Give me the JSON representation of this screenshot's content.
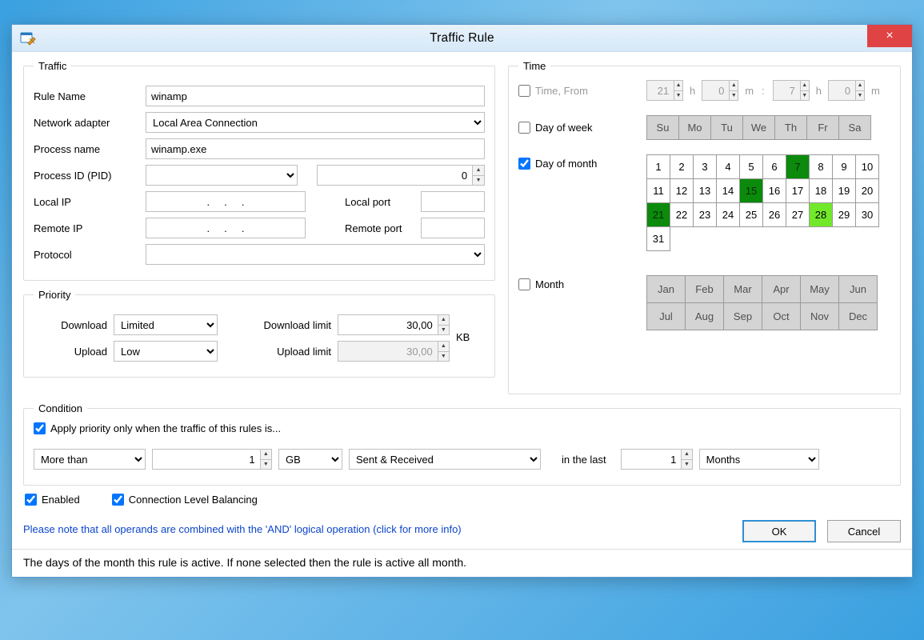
{
  "window": {
    "title": "Traffic Rule",
    "close_label": "×"
  },
  "traffic": {
    "legend": "Traffic",
    "rule_name_label": "Rule Name",
    "rule_name": "winamp",
    "network_adapter_label": "Network adapter",
    "network_adapter": "Local Area Connection",
    "process_name_label": "Process name",
    "process_name": "winamp.exe",
    "pid_label": "Process ID (PID)",
    "pid_select": "",
    "pid_value": "0",
    "local_ip_label": "Local IP",
    "local_ip": ".     .     .",
    "local_port_label": "Local port",
    "local_port": "",
    "remote_ip_label": "Remote IP",
    "remote_ip": ".     .     .",
    "remote_port_label": "Remote port",
    "remote_port": "",
    "protocol_label": "Protocol",
    "protocol": ""
  },
  "priority": {
    "legend": "Priority",
    "download_label": "Download",
    "download": "Limited",
    "download_limit_label": "Download limit",
    "download_limit": "30,00",
    "upload_label": "Upload",
    "upload": "Low",
    "upload_limit_label": "Upload limit",
    "upload_limit": "30,00",
    "unit": "KB"
  },
  "time": {
    "legend": "Time",
    "time_from_label": "Time, From",
    "time_from_checked": false,
    "from_h": "21",
    "from_m": "0",
    "to_h": "7",
    "to_m": "0",
    "h_unit": "h",
    "m_unit": "m",
    "sep": ":",
    "dow_label": "Day of week",
    "dow_checked": false,
    "dow": [
      "Su",
      "Mo",
      "Tu",
      "We",
      "Th",
      "Fr",
      "Sa"
    ],
    "dom_label": "Day of month",
    "dom_checked": true,
    "dom_days": 31,
    "dom_selected_dark": [
      7,
      15,
      21
    ],
    "dom_selected_light": [
      28
    ],
    "month_label": "Month",
    "month_checked": false,
    "months": [
      "Jan",
      "Feb",
      "Mar",
      "Apr",
      "May",
      "Jun",
      "Jul",
      "Aug",
      "Sep",
      "Oct",
      "Nov",
      "Dec"
    ]
  },
  "condition": {
    "legend": "Condition",
    "apply_label": "Apply priority only when the traffic of this rules is...",
    "apply_checked": true,
    "comparator": "More than",
    "amount": "1",
    "unit": "GB",
    "direction": "Sent & Received",
    "in_last_label": "in the last",
    "period_amount": "1",
    "period_unit": "Months"
  },
  "footer": {
    "enabled_label": "Enabled",
    "enabled_checked": true,
    "clb_label": "Connection Level Balancing",
    "clb_checked": true,
    "note": "Please note that all operands are combined with the 'AND' logical operation (click for more info)",
    "ok": "OK",
    "cancel": "Cancel"
  },
  "status": "The days of the month this rule is active. If none selected then the rule is active all month."
}
